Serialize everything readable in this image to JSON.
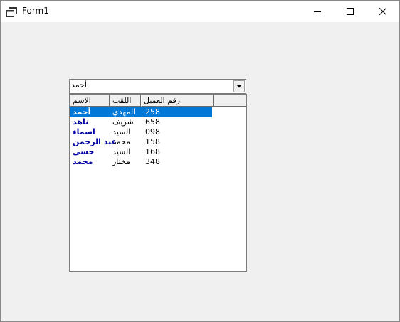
{
  "window": {
    "title": "Form1",
    "icon": "form-window-icon",
    "buttons": [
      "minimize-icon",
      "maximize-icon",
      "close-icon"
    ]
  },
  "combo": {
    "value": "أحمد"
  },
  "listview": {
    "columns": [
      "الاسم",
      "اللقب",
      "رقم العميل"
    ],
    "rows": [
      {
        "name": "أحمد",
        "title": "المهدي",
        "number": "258",
        "selected": true
      },
      {
        "name": "ناهد",
        "title": "شريف",
        "number": "658"
      },
      {
        "name": "اسماء",
        "title": "السيد",
        "number": "098"
      },
      {
        "name": "عبد الرحمن",
        "title": "محمد",
        "number": "158"
      },
      {
        "name": "حسي",
        "title": "السيد",
        "number": "168"
      },
      {
        "name": "محمد",
        "title": "مختار",
        "number": "348"
      }
    ],
    "colors": {
      "selection": "#0078d7",
      "name_text": "#0000a0"
    }
  }
}
